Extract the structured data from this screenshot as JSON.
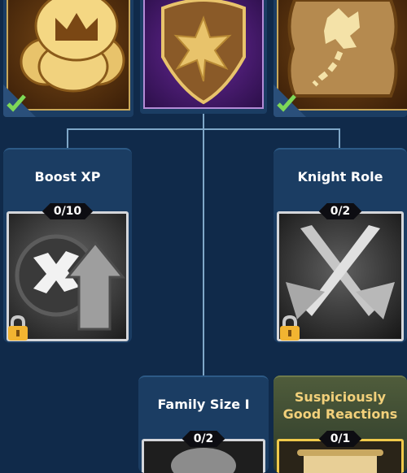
{
  "top_row": [
    {
      "name": "crown-coins",
      "completed": true
    },
    {
      "name": "sheriff-badge",
      "completed": false
    },
    {
      "name": "treasure-map",
      "completed": true
    }
  ],
  "perks": [
    {
      "title": "Boost XP",
      "progress": "0/10",
      "locked": true,
      "icon": "boost-xp-arrow-icon"
    },
    {
      "title": "Knight Role",
      "progress": "0/2",
      "locked": true,
      "icon": "crossed-swords-icon"
    },
    {
      "title": "Family Size I",
      "progress": "0/2",
      "locked": false,
      "icon": "family-icon"
    },
    {
      "title": "Suspiciously\nGood Reactions",
      "progress": "0/1",
      "locked": false,
      "icon": "scroll-icon"
    }
  ],
  "colors": {
    "background": "#102a4a",
    "card": "#1b3d63",
    "gold_card": "#4f5c3b",
    "connector": "#7fa7c8",
    "check": "#7ed957",
    "gold_text": "#f2d07a"
  }
}
